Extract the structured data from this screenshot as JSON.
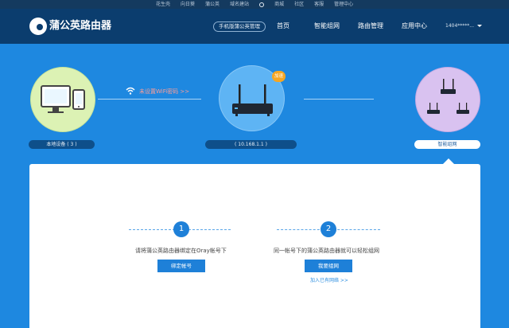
{
  "topbar": {
    "items": [
      "花生壳",
      "向日葵",
      "蒲公英",
      "域名建站",
      "商城",
      "社区",
      "客服",
      "管理中心"
    ]
  },
  "navbar": {
    "brand": "蒲公英路由器",
    "mobile_button": "手机版蒲公英管理",
    "links": [
      "首页",
      "智能组网",
      "路由管理",
      "应用中心"
    ],
    "user": "1404*****..."
  },
  "topology": {
    "local_devices_label": "本地设备 ( 3 )",
    "router_ip_label": "( 10.168.1.1 )",
    "router_badge": "加速",
    "wifi_warning": "未设置WiFi密码 >>",
    "smart_network_label": "智能组网"
  },
  "steps": [
    {
      "number": "1",
      "text": "请将蒲公英路由器绑定在Oray帐号下",
      "button": "绑定帐号"
    },
    {
      "number": "2",
      "text": "同一帐号下的蒲公英路由器就可以轻松组网",
      "button": "我要组网",
      "link": "加入已有网络 >>"
    }
  ],
  "colors": {
    "background": "#1e88e0",
    "navbar": "#0b3d6e",
    "topbar": "#143a5f",
    "accent": "#1e80d8",
    "warning": "#ff9d96",
    "badge": "#f5a623"
  }
}
